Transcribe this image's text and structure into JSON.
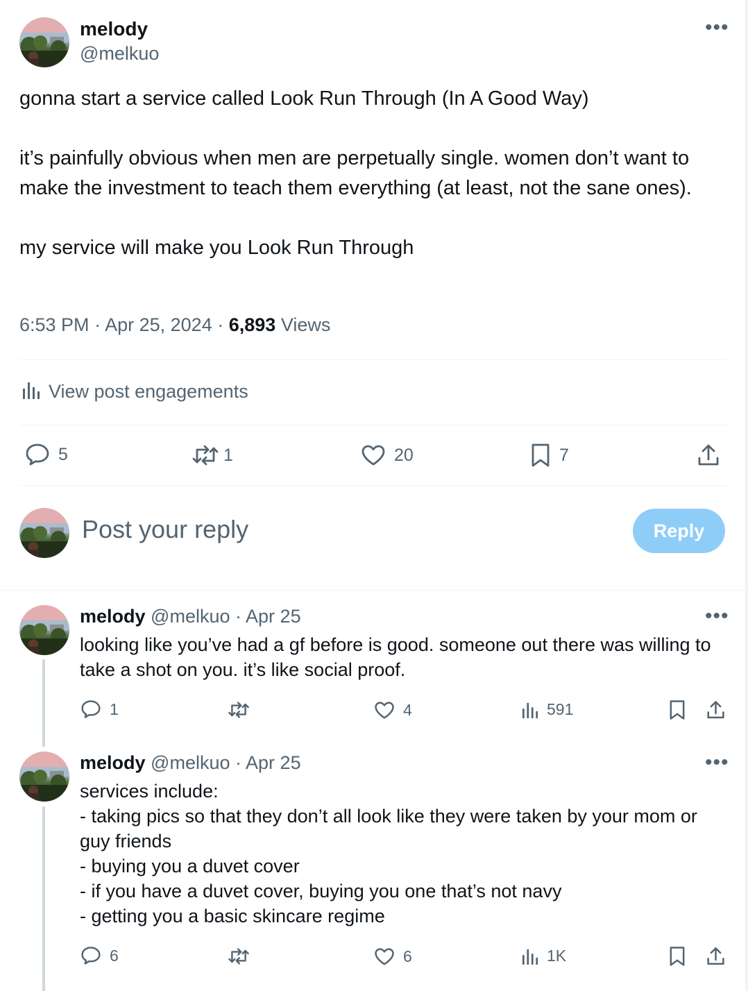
{
  "main_post": {
    "author_name": "melody",
    "author_handle": "@melkuo",
    "text": "gonna start a service called Look Run Through (In A Good Way)\n\nit’s painfully obvious when men are perpetually single. women don’t want to make the investment to teach them everything (at least, not the sane ones).\n\nmy service will make you Look Run Through",
    "time": "6:53 PM",
    "date": "Apr 25, 2024",
    "separator": "·",
    "views_count": "6,893",
    "views_label": "Views",
    "engagements_label": "View post engagements",
    "replies": "5",
    "reposts": "1",
    "likes": "20",
    "bookmarks": "7"
  },
  "composer": {
    "placeholder": "Post your reply",
    "button_label": "Reply"
  },
  "replies": [
    {
      "author_name": "melody",
      "author_handle": "@melkuo",
      "date": "Apr 25",
      "text": "looking like you’ve had a gf before is good. someone out there was willing to\ntake a shot on you. it’s like social proof.",
      "replies": "1",
      "reposts": "",
      "likes": "4",
      "views": "591"
    },
    {
      "author_name": "melody",
      "author_handle": "@melkuo",
      "date": "Apr 25",
      "text": "services include:\n- taking pics so that they don’t all look like they were taken by your mom or\nguy friends\n- buying you a duvet cover\n- if you have a duvet cover, buying you one that’s not navy\n- getting you a basic skincare regime",
      "replies": "6",
      "reposts": "",
      "likes": "6",
      "views": "1K"
    }
  ],
  "colors": {
    "text": "#0f1419",
    "muted": "#536471",
    "divider": "#eff3f4",
    "reply_button": "#8ecdf8",
    "thread_line": "#cfd9de"
  }
}
